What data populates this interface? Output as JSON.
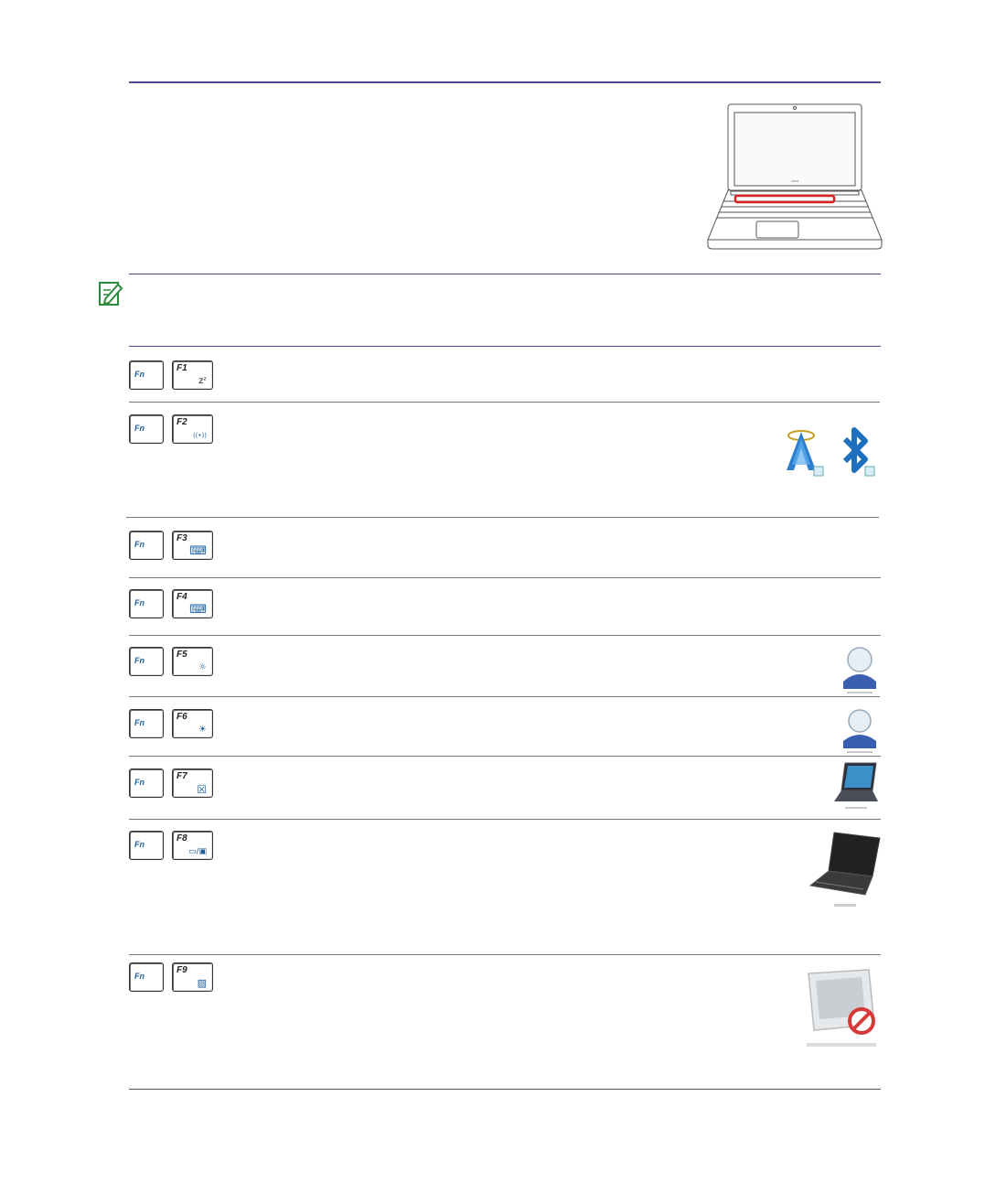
{
  "note_icon": "note-pencil-icon",
  "rows": [
    {
      "fn": "Fn",
      "key": "F1",
      "icon": "zz-sleep-icon",
      "glyph": "zᶻ"
    },
    {
      "fn": "Fn",
      "key": "F2",
      "icon": "wireless-antenna-icon",
      "glyph": "((•))"
    },
    {
      "fn": "Fn",
      "key": "F3",
      "icon": "keyboard-backlight-down-icon",
      "glyph": "⌨"
    },
    {
      "fn": "Fn",
      "key": "F4",
      "icon": "keyboard-backlight-up-icon",
      "glyph": "⌨"
    },
    {
      "fn": "Fn",
      "key": "F5",
      "icon": "brightness-down-icon",
      "glyph": "☼"
    },
    {
      "fn": "Fn",
      "key": "F6",
      "icon": "brightness-up-icon",
      "glyph": "☀"
    },
    {
      "fn": "Fn",
      "key": "F7",
      "icon": "lcd-off-icon",
      "glyph": "☒"
    },
    {
      "fn": "Fn",
      "key": "F8",
      "icon": "display-toggle-icon",
      "glyph": "▭/▣"
    },
    {
      "fn": "Fn",
      "key": "F9",
      "icon": "touchpad-icon",
      "glyph": "▨"
    }
  ],
  "colors": {
    "accent": "#4b4b8c",
    "key_label": "#1a5e9c",
    "note_green": "#2e8b3e",
    "highlight_red": "#e02020"
  }
}
